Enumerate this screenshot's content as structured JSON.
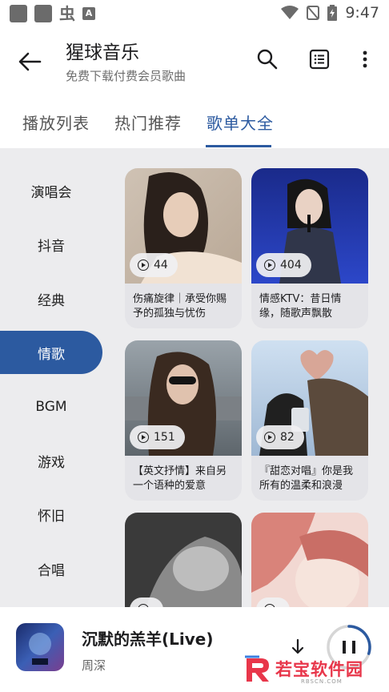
{
  "status_bar": {
    "time": "9:47",
    "icons": [
      "square-icon",
      "square-icon",
      "bug-icon",
      "a-icon",
      "wifi-icon",
      "no-signal-icon",
      "battery-charging-icon"
    ]
  },
  "app_bar": {
    "title": "猩球音乐",
    "subtitle": "免费下载付费会员歌曲"
  },
  "tabs": [
    {
      "label": "播放列表",
      "active": false
    },
    {
      "label": "热门推荐",
      "active": false
    },
    {
      "label": "歌单大全",
      "active": true
    }
  ],
  "categories": [
    {
      "label": "演唱会",
      "active": false
    },
    {
      "label": "抖音",
      "active": false
    },
    {
      "label": "经典",
      "active": false
    },
    {
      "label": "情歌",
      "active": true
    },
    {
      "label": "BGM",
      "active": false
    },
    {
      "label": "游戏",
      "active": false
    },
    {
      "label": "怀旧",
      "active": false
    },
    {
      "label": "合唱",
      "active": false
    }
  ],
  "playlists": [
    {
      "count": "44",
      "title": "伤痛旋律｜承受你赐予的孤独与忧伤"
    },
    {
      "count": "404",
      "title": "情感KTV：昔日情缘，随歌声飘散"
    },
    {
      "count": "151",
      "title": "【英文抒情】来自另一个语种的爱意"
    },
    {
      "count": "82",
      "title": "『甜恋对唱』你是我所有的温柔和浪漫"
    },
    {
      "count": "",
      "title": ""
    },
    {
      "count": "",
      "title": ""
    }
  ],
  "now_playing": {
    "song": "沉默的羔羊(Live)",
    "artist": "周深",
    "progress": 0.3
  },
  "watermark": {
    "text": "若宝软件园",
    "sub": "RBSCN.COM"
  },
  "colors": {
    "accent": "#2c5aa0",
    "background": "#ececee",
    "card": "#e4e4e8",
    "watermark": "#e8364a"
  }
}
